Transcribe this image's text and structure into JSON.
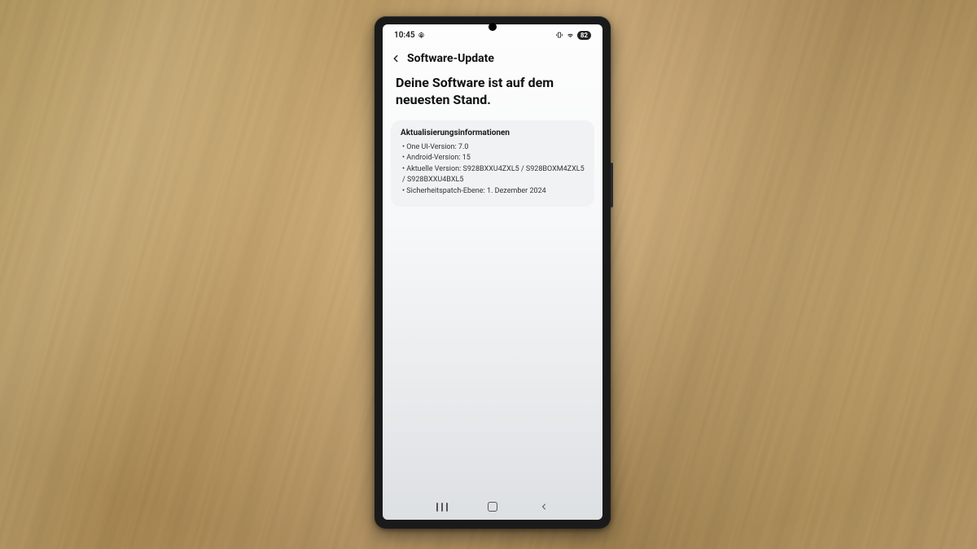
{
  "status_bar": {
    "time": "10:45",
    "battery_pct": "82"
  },
  "header": {
    "title": "Software-Update"
  },
  "main": {
    "headline": "Deine Software ist auf dem neuesten Stand."
  },
  "info_card": {
    "title": "Aktualisierungsinformationen",
    "items": [
      "One UI-Version: 7.0",
      "Android-Version: 15",
      "Aktuelle Version: S928BXXU4ZXL5 / S928BOXM4ZXL5 / S928BXXU4BXL5",
      "Sicherheitspatch-Ebene: 1. Dezember 2024"
    ]
  }
}
